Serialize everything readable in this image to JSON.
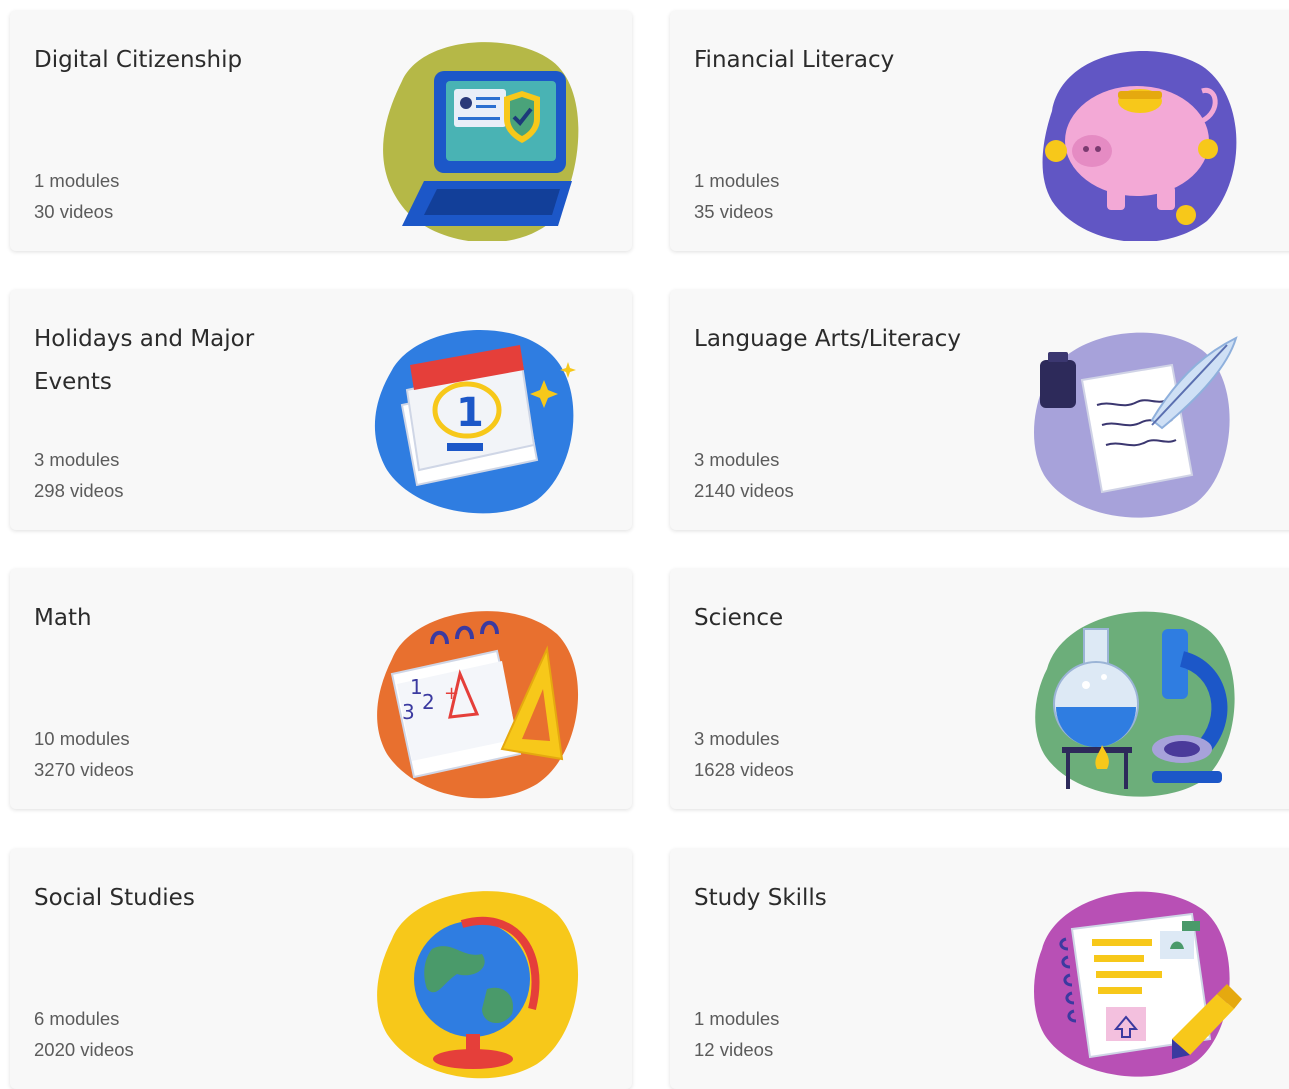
{
  "cards": [
    {
      "title": "Digital Citizenship",
      "modules": "1 modules",
      "videos": "30 videos",
      "icon": "laptop-security-icon",
      "bg": "#b5b847"
    },
    {
      "title": "Financial Literacy",
      "modules": "1 modules",
      "videos": "35 videos",
      "icon": "piggy-bank-icon",
      "bg": "#6156c4"
    },
    {
      "title": "Holidays and Major Events",
      "modules": "3 modules",
      "videos": "298 videos",
      "icon": "calendar-icon",
      "bg": "#2f7de1"
    },
    {
      "title": "Language Arts/Literacy",
      "modules": "3 modules",
      "videos": "2140 videos",
      "icon": "quill-ink-icon",
      "bg": "#a7a2da"
    },
    {
      "title": "Math",
      "modules": "10 modules",
      "videos": "3270 videos",
      "icon": "math-notepad-icon",
      "bg": "#e8702f"
    },
    {
      "title": "Science",
      "modules": "3 modules",
      "videos": "1628 videos",
      "icon": "flask-microscope-icon",
      "bg": "#6cae7a"
    },
    {
      "title": "Social Studies",
      "modules": "6 modules",
      "videos": "2020 videos",
      "icon": "globe-icon",
      "bg": "#f7c81a"
    },
    {
      "title": "Study Skills",
      "modules": "1 modules",
      "videos": "12 videos",
      "icon": "notebook-highlighter-icon",
      "bg": "#b850b5"
    }
  ]
}
